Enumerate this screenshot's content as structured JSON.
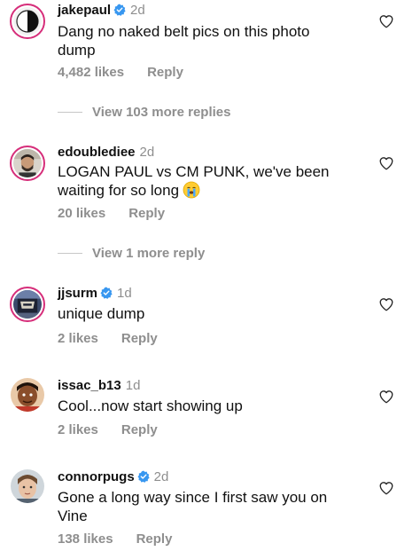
{
  "comments": [
    {
      "username": "jakepaul",
      "verified": true,
      "time": "2d",
      "text": "Dang no naked belt pics on this photo dump",
      "likes": "4,482 likes",
      "reply": "Reply",
      "view_more": "View 103 more replies"
    },
    {
      "username": "edoublediee",
      "verified": false,
      "time": "2d",
      "text": "LOGAN PAUL vs CM PUNK, we've been waiting for so long",
      "emoji": "loudly-crying-face-emoji",
      "likes": "20 likes",
      "reply": "Reply",
      "view_more": "View 1 more reply"
    },
    {
      "username": "jjsurm",
      "verified": true,
      "time": "1d",
      "text": "unique dump",
      "likes": "2 likes",
      "reply": "Reply"
    },
    {
      "username": "issac_b13",
      "verified": false,
      "time": "1d",
      "text": "Cool...now start showing up",
      "likes": "2 likes",
      "reply": "Reply"
    },
    {
      "username": "connorpugs",
      "verified": true,
      "time": "2d",
      "text": "Gone a long way since I first saw you on Vine",
      "likes": "138 likes",
      "reply": "Reply"
    }
  ],
  "icons": {
    "like": "heart-outline-icon",
    "verified": "verified-badge-icon"
  },
  "colors": {
    "verified_blue": "#3897f0",
    "secondary_text": "#8e8e8e",
    "story_ring": "#d62e7a"
  }
}
